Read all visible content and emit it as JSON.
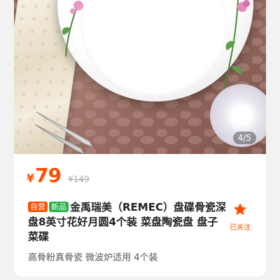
{
  "gallery": {
    "counter": "4/5"
  },
  "price": {
    "symbol": "¥",
    "amount": "79",
    "original": "¥149"
  },
  "product": {
    "tags": [
      "自营",
      "新品"
    ],
    "title": "金禹瑞美（REMEC）盘碟骨瓷深盘8英寸花好月圆4个装 菜盘陶瓷盘 盘子 菜碟",
    "subtitle": "高骨粉真骨瓷 微波炉适用 4个装"
  },
  "follow": {
    "label": "已关注"
  },
  "colors": {
    "accent": "#ff5000",
    "tag_self": "#ff4d00",
    "tag_new": "#27b04a"
  }
}
